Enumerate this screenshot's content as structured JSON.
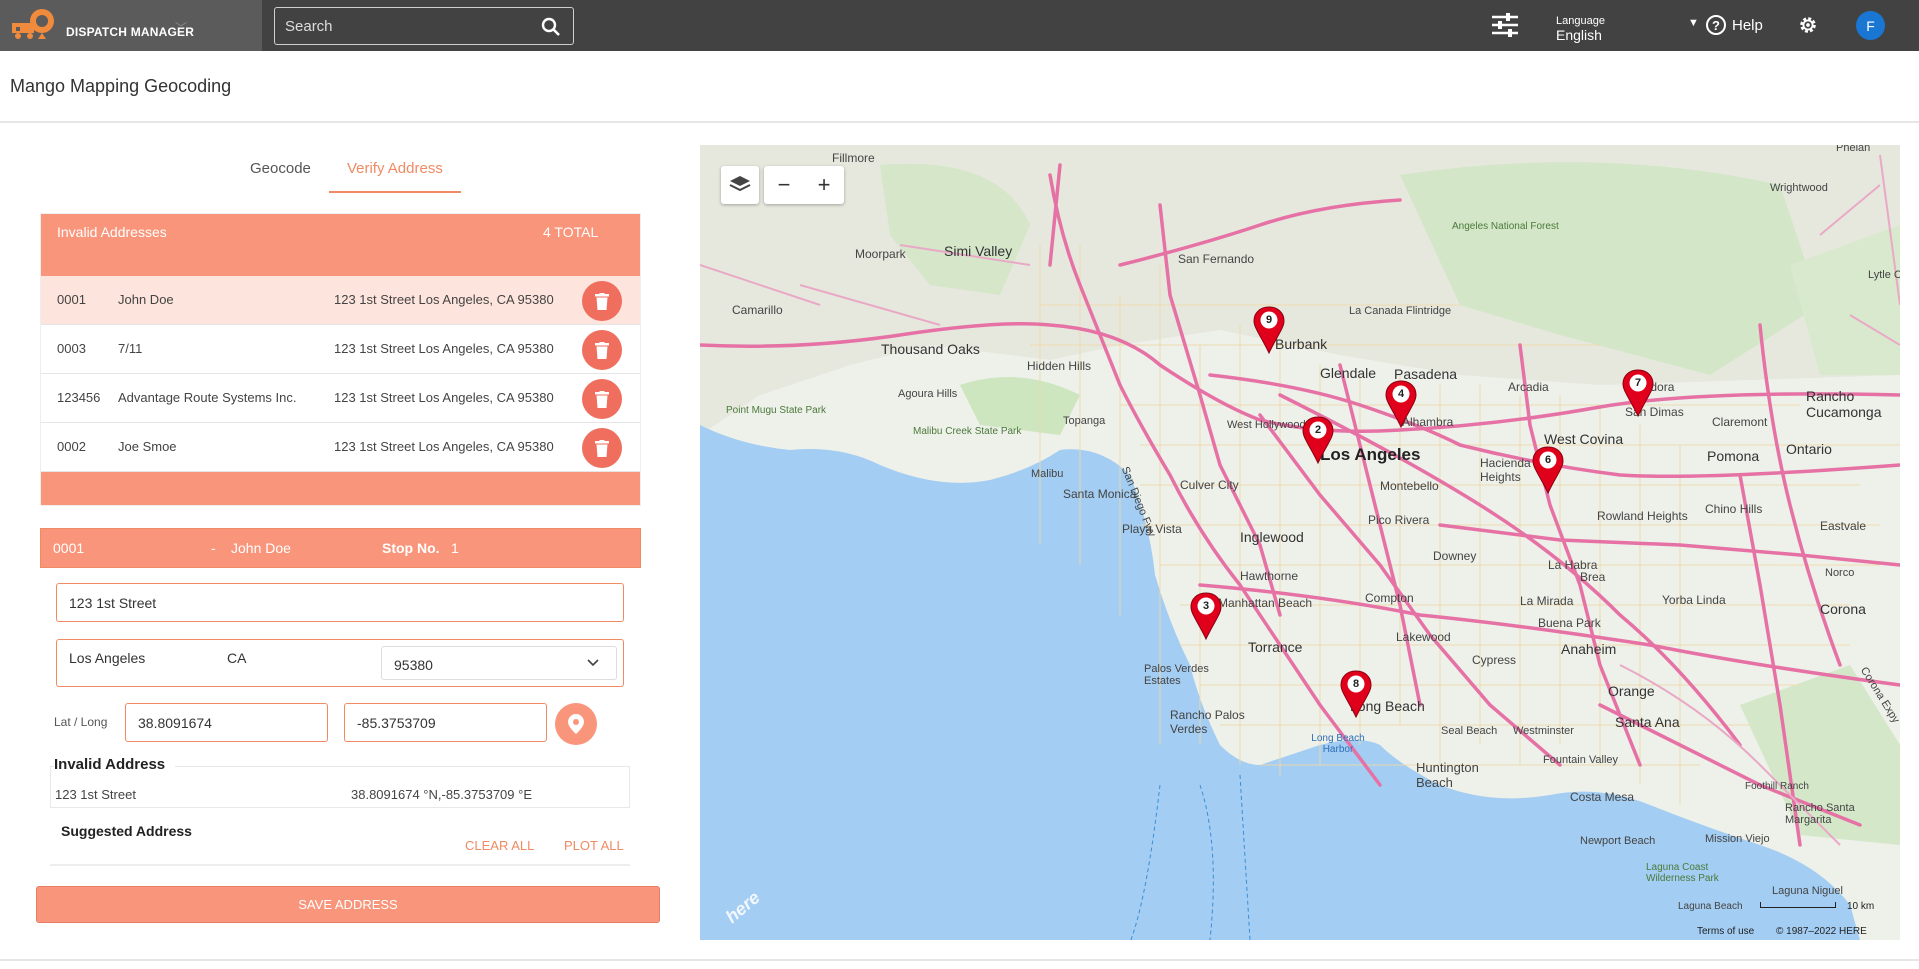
{
  "header": {
    "app_name": "DISPATCH MANAGER",
    "search_placeholder": "Search",
    "language_label": "Language",
    "language_value": "English",
    "help_label": "Help",
    "avatar_initial": "F"
  },
  "page": {
    "title": "Mango Mapping Geocoding"
  },
  "tabs": [
    {
      "label": "Geocode"
    },
    {
      "label": "Verify Address"
    }
  ],
  "invalid": {
    "title": "Invalid Addresses",
    "count": "4 TOTAL",
    "rows": [
      {
        "id": "0001",
        "name": "John Doe",
        "address": "123 1st Street Los Angeles, CA 95380"
      },
      {
        "id": "0003",
        "name": "7/11",
        "address": "123 1st Street Los Angeles, CA 95380"
      },
      {
        "id": "123456",
        "name": "Advantage Route Systems Inc.",
        "address": "123 1st Street Los Angeles, CA 95380"
      },
      {
        "id": "0002",
        "name": "Joe Smoe",
        "address": "123 1st Street Los Angeles, CA 95380"
      }
    ]
  },
  "detail": {
    "id": "0001",
    "sep": "-",
    "name": "John Doe",
    "stop_label": "Stop No.",
    "stop_value": "1",
    "street": "123 1st Street",
    "city": "Los Angeles",
    "state": "CA",
    "zip": "95380",
    "latlong_label": "Lat / Long",
    "lat": "38.8091674",
    "long": "-85.3753709",
    "invalid_title": "Invalid Address",
    "invalid_street": "123 1st Street",
    "invalid_coords": "38.8091674 °N,-85.3753709 °E",
    "suggested_title": "Suggested Address",
    "clear_all": "CLEAR ALL",
    "plot_all": "PLOT ALL"
  },
  "save_label": "SAVE ADDRESS",
  "map": {
    "labels": [
      "Fillmore",
      "Simi Valley",
      "Moorpark",
      "San Fernando",
      "Camarillo",
      "Thousand Oaks",
      "Hidden Hills",
      "Burbank",
      "La Canada Flintridge",
      "Glendale",
      "Pasadena",
      "Angeles National Forest",
      "Wrightwood",
      "Phelan",
      "Lytle Cr",
      "Agoura Hills",
      "Point Mugu State Park",
      "Malibu Creek State Park",
      "Topanga",
      "Malibu",
      "West Hollywood",
      "Los Angeles",
      "Alhambra",
      "Arcadia",
      "Glendora",
      "San Dimas",
      "Claremont",
      "Rancho Cucamonga",
      "West Covina",
      "Pomona",
      "Ontario",
      "Santa Monica",
      "Culver City",
      "Montebello",
      "Hacienda Heights",
      "Chino Hills",
      "Rowland Heights",
      "Playa Vista",
      "Inglewood",
      "Pico Rivera",
      "Eastvale",
      "Downey",
      "Hawthorne",
      "La Habra",
      "Brea",
      "Norco",
      "Manhattan Beach",
      "Compton",
      "La Mirada",
      "Yorba Linda",
      "Corona",
      "Torrance",
      "Lakewood",
      "Buena Park",
      "Anaheim",
      "Palos Verdes Estates",
      "Cypress",
      "Orange",
      "Rancho Palos Verdes",
      "Long Beach",
      "Seal Beach",
      "Westminster",
      "Santa Ana",
      "Long Beach Harbor",
      "Fountain Valley",
      "Huntington Beach",
      "Costa Mesa",
      "Foothill Ranch",
      "Rancho Santa Margarita",
      "Newport Beach",
      "Mission Viejo",
      "Laguna Coast Wilderness Park",
      "Laguna Niguel",
      "Laguna Beach",
      "San Diego Fwy",
      "Corona Expy"
    ],
    "markers": [
      "9",
      "2",
      "4",
      "7",
      "6",
      "3",
      "8"
    ],
    "scale": "10 km",
    "terms": "Terms of use",
    "copyright": "© 1987–2022 HERE",
    "watermark": "here",
    "colors": {
      "water": "#a3cdf2",
      "land": "#eef0ea",
      "park": "#cde6c0",
      "highway": "#e672a5",
      "accent": "#f9957a",
      "marker": "#e0001b"
    }
  }
}
